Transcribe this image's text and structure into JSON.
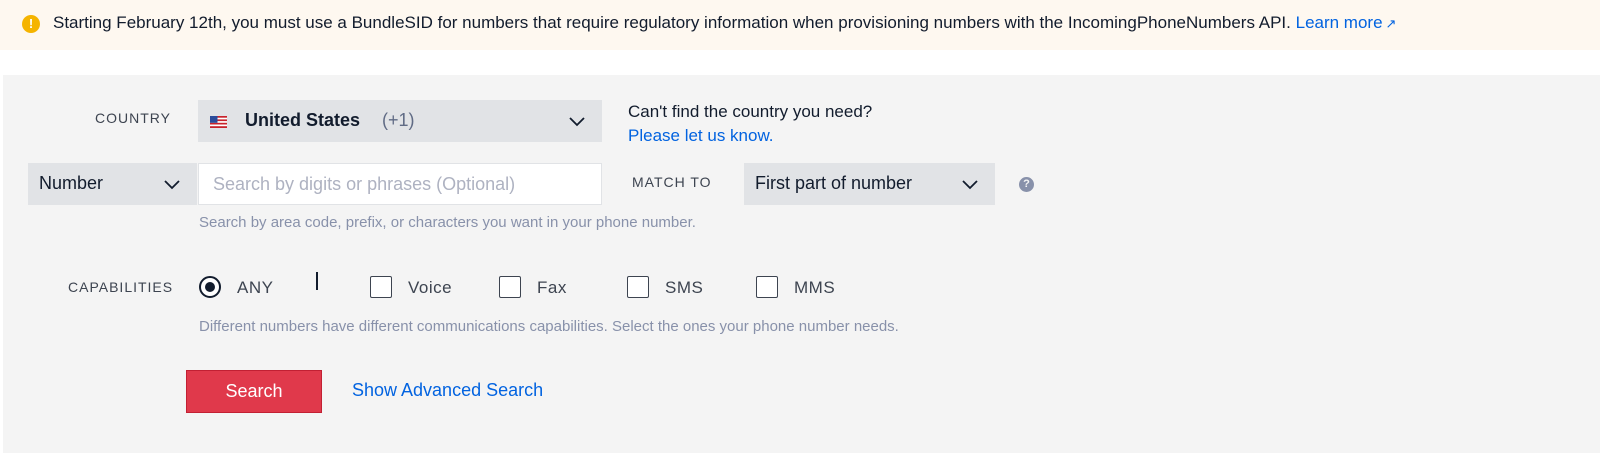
{
  "banner": {
    "icon": "info-icon",
    "message": "Starting February 12th, you must use a BundleSID for numbers that require regulatory information when provisioning numbers with the IncomingPhoneNumbers API.",
    "link_label": "Learn more",
    "link_arrow": "↗"
  },
  "country": {
    "label": "COUNTRY",
    "selected_name": "United States",
    "selected_code": "(+1)",
    "flag_icon": "us-flag-icon",
    "help_title": "Can't find the country you need?",
    "help_link": "Please let us know."
  },
  "search": {
    "type_selected": "Number",
    "placeholder": "Search by digits or phrases (Optional)",
    "value": "",
    "match_label": "MATCH TO",
    "match_selected": "First part of number",
    "help_text": "Search by area code, prefix, or characters you want in your phone number."
  },
  "capabilities": {
    "label": "CAPABILITIES",
    "any_label": "ANY",
    "options": [
      {
        "label": "Voice",
        "checked": false
      },
      {
        "label": "Fax",
        "checked": false
      },
      {
        "label": "SMS",
        "checked": false
      },
      {
        "label": "MMS",
        "checked": false
      }
    ],
    "help_text": "Different numbers have different communications capabilities. Select the ones your phone number needs."
  },
  "actions": {
    "search_label": "Search",
    "advanced_label": "Show Advanced Search"
  },
  "colors": {
    "accent_link": "#0263e0",
    "primary_button": "#e0394b",
    "warning": "#f5b400",
    "panel_bg": "#f4f4f4"
  }
}
